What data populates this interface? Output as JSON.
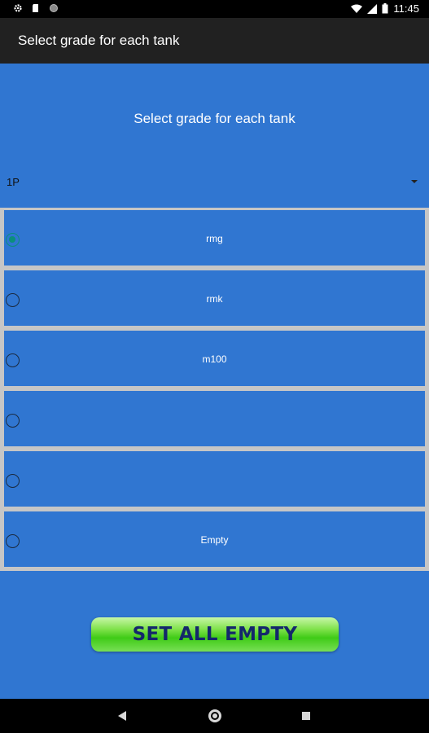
{
  "status_bar": {
    "time": "11:45",
    "icons": [
      "gear-icon",
      "sd-card-icon",
      "circle-icon",
      "wifi-icon",
      "signal-icon",
      "battery-icon"
    ]
  },
  "app_bar": {
    "title": "Select grade for each tank"
  },
  "heading": "Select grade for each tank",
  "tank_selector": {
    "value": "1P"
  },
  "grades": [
    {
      "label": "rmg",
      "checked": true
    },
    {
      "label": "rmk",
      "checked": false
    },
    {
      "label": "m100",
      "checked": false
    },
    {
      "label": "",
      "checked": false
    },
    {
      "label": "",
      "checked": false
    },
    {
      "label": "Empty",
      "checked": false
    }
  ],
  "set_all_empty_label": "SET ALL EMPTY",
  "colors": {
    "background": "#3076d1",
    "app_bar": "#212121",
    "radio_checked": "#0b8f7c",
    "button_text": "#14276b"
  }
}
